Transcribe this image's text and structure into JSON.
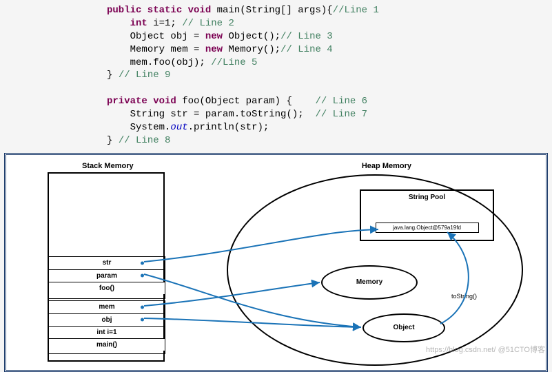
{
  "code": {
    "main": {
      "sig_mods": "public static void",
      "sig_name": " main(String[] args){",
      "sig_cmt": "//Line 1",
      "l2_kw": "int",
      "l2_rest": " i=1; ",
      "l2_cmt": "// Line 2",
      "l3a": "Object obj = ",
      "l3_new": "new",
      "l3b": " Object();",
      "l3_cmt": "// Line 3",
      "l4a": "Memory mem = ",
      "l4_new": "new",
      "l4b": " Memory();",
      "l4_cmt": "// Line 4",
      "l5a": "mem.foo(obj); ",
      "l5_cmt": "//Line 5",
      "l9a": "} ",
      "l9_cmt": "// Line 9"
    },
    "foo": {
      "sig_mods": "private void",
      "sig_name": " foo(Object param) {    ",
      "sig_cmt": "// Line 6",
      "l7a": "String str = param.toString();  ",
      "l7_cmt": "// Line 7",
      "l_print_a": "System.",
      "l_print_out": "out",
      "l_print_b": ".println(str);",
      "l8a": "} ",
      "l8_cmt": "// Line 8"
    }
  },
  "diagram": {
    "stack_label": "Stack Memory",
    "heap_label": "Heap Memory",
    "string_pool_label": "String Pool",
    "string_obj": "java.lang.Object@579a19fd",
    "memory_oval": "Memory",
    "object_oval": "Object",
    "tostring_label": "toString()",
    "foo_frame": {
      "rows": [
        "str",
        "param"
      ],
      "name": "foo()"
    },
    "main_frame": {
      "rows": [
        "mem",
        "obj",
        "int i=1"
      ],
      "name": "main()"
    }
  },
  "watermark": "https://blog.csdn.net/ @51CTO博客"
}
